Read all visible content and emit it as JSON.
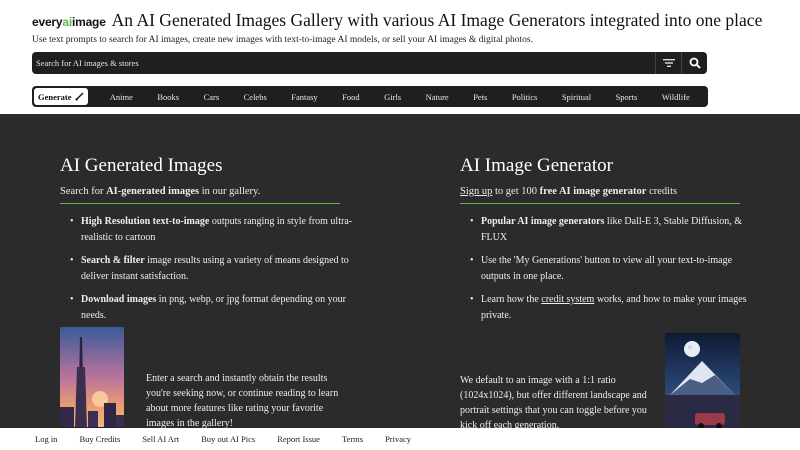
{
  "header": {
    "logo": {
      "part1": "every",
      "part2": "ai",
      "part3": "image"
    },
    "title": "An AI Generated Images Gallery with various AI Image Generators integrated into one place",
    "tagline": "Use text prompts to search for AI images, create new images with text-to-image AI models, or sell your AI images & digital photos."
  },
  "search": {
    "placeholder": "Search for AI images & stores"
  },
  "categories": {
    "generate": "Generate",
    "items": [
      "Anime",
      "Books",
      "Cars",
      "Celebs",
      "Fantasy",
      "Food",
      "Girls",
      "Nature",
      "Pets",
      "Politics",
      "Spiritual",
      "Sports",
      "Wildlife"
    ]
  },
  "left": {
    "heading": "AI Generated Images",
    "sub_pre": "Search for ",
    "sub_bold": "AI-generated images",
    "sub_post": " in our gallery.",
    "bullets": [
      {
        "bold": "High Resolution text-to-image",
        "text": " outputs ranging in style from ultra-realistic to cartoon"
      },
      {
        "bold": "Search & filter",
        "text": " image results using a variety of means designed to deliver instant satisfaction."
      },
      {
        "bold": "Download images",
        "text": " in png, webp, or jpg format depending on your needs."
      }
    ],
    "paragraph": "Enter a search and instantly obtain the results you're seeking now, or continue reading to learn about more features like rating your favorite images in the gallery!"
  },
  "right": {
    "heading": "AI Image Generator",
    "sub_link": "Sign up",
    "sub_pre": " to get 100 ",
    "sub_bold": "free AI image generator",
    "sub_post": " credits",
    "bullet1_bold": "Popular AI image generators",
    "bullet1_text": " like Dall-E 3, Stable Diffusion, & FLUX",
    "bullet2_text": "Use the 'My Generations' button to view all your text-to-image outputs in one place.",
    "bullet3_pre": "Learn how the ",
    "bullet3_link": "credit system",
    "bullet3_post": " works, and how to make your images private.",
    "paragraph": "We default to an image with a 1:1 ratio (1024x1024), but offer different landscape and portrait settings that you can toggle before you kick off each generation."
  },
  "footer": {
    "links": [
      "Log in",
      "Buy Credits",
      "Sell AI Art",
      "Buy out AI Pics",
      "Report Issue",
      "Terms",
      "Privacy"
    ]
  },
  "colors": {
    "accent": "#5fb84a",
    "dark_bg": "#2b2b2b",
    "bar_bg": "#1f1f1f"
  }
}
